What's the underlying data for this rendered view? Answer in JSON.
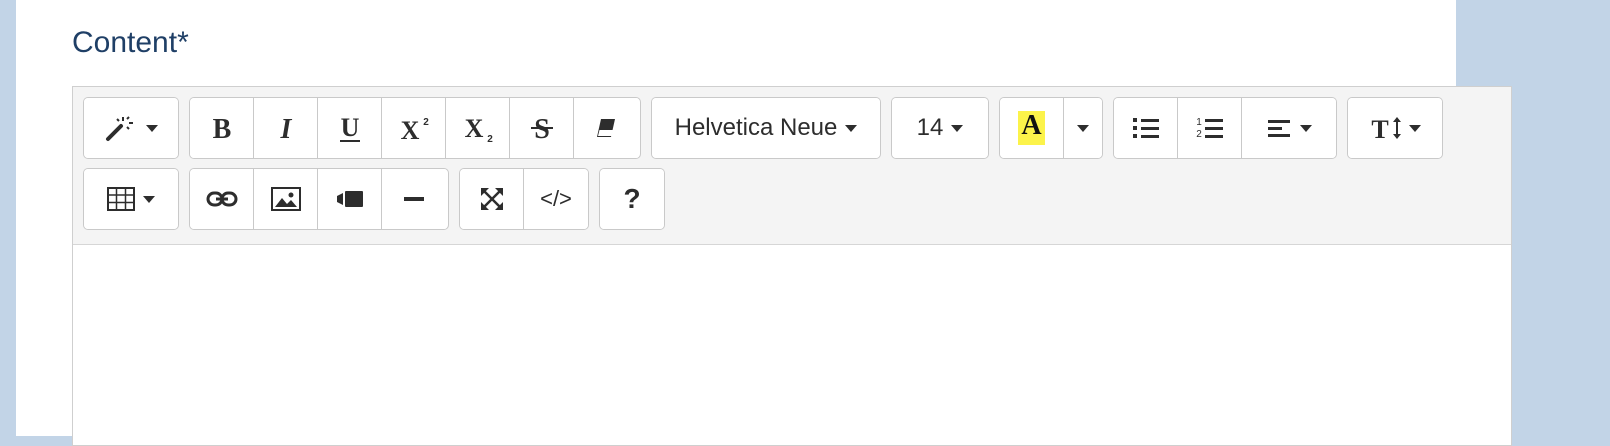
{
  "field": {
    "label": "Content*"
  },
  "toolbar": {
    "font_family": "Helvetica Neue",
    "font_size": "14",
    "color_letter": "A",
    "highlight_color": "#fcf34a",
    "code_view_label": "</>",
    "help_label": "?"
  },
  "icons": {
    "style": "magic-icon",
    "bold": "bold-icon",
    "italic": "italic-icon",
    "underline": "underline-icon",
    "superscript": "superscript-icon",
    "subscript": "subscript-icon",
    "strikethrough": "strikethrough-icon",
    "eraser": "eraser-icon",
    "unordered_list": "unordered-list-icon",
    "ordered_list": "ordered-list-icon",
    "align": "align-left-icon",
    "line_height": "text-height-icon",
    "table": "table-icon",
    "link": "link-icon",
    "picture": "picture-icon",
    "video": "video-icon",
    "hr": "horizontal-rule-icon",
    "fullscreen": "fullscreen-icon"
  },
  "colors": {
    "label": "#1f3f66",
    "toolbar_bg": "#f4f4f4",
    "page_bg": "#c2d4e7"
  }
}
